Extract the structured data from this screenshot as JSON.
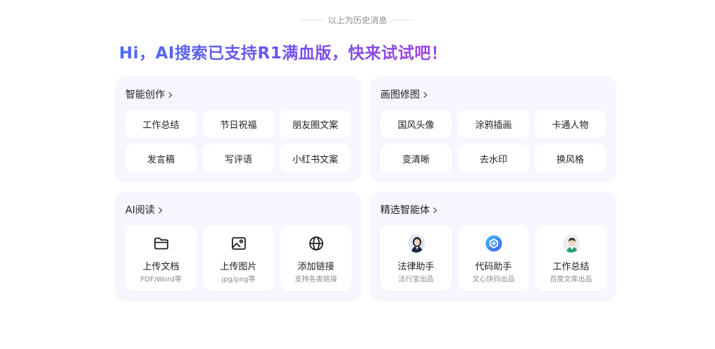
{
  "history_divider": "以上为历史消息",
  "headline": "Hi，AI搜索已支持R1满血版，快来试试吧！",
  "cards": {
    "smart_create": {
      "title": "智能创作",
      "chips": [
        "工作总结",
        "节日祝福",
        "朋友圈文案",
        "发言稿",
        "写评语",
        "小红书文案"
      ]
    },
    "image_edit": {
      "title": "画图修图",
      "chips": [
        "国风头像",
        "涂鸦插画",
        "卡通人物",
        "变清晰",
        "去水印",
        "换风格"
      ]
    },
    "ai_read": {
      "title": "AI阅读",
      "tiles": [
        {
          "label": "上传文档",
          "sub": "PDF/Word等",
          "icon": "folder-icon"
        },
        {
          "label": "上传图片",
          "sub": "jpg/png等",
          "icon": "image-icon"
        },
        {
          "label": "添加链接",
          "sub": "支持各类链接",
          "icon": "globe-icon"
        }
      ]
    },
    "agents": {
      "title": "精选智能体",
      "tiles": [
        {
          "label": "法律助手",
          "sub": "法行宝出品",
          "icon": "lawyer-avatar-icon"
        },
        {
          "label": "代码助手",
          "sub": "文心快码出品",
          "icon": "code-logo-icon"
        },
        {
          "label": "工作总结",
          "sub": "百度文库出品",
          "icon": "worker-avatar-icon"
        }
      ]
    }
  },
  "colors": {
    "card_bg": "#f5f6fe",
    "headline_gradient_start": "#4d6cf0",
    "headline_gradient_end": "#a241e0"
  }
}
